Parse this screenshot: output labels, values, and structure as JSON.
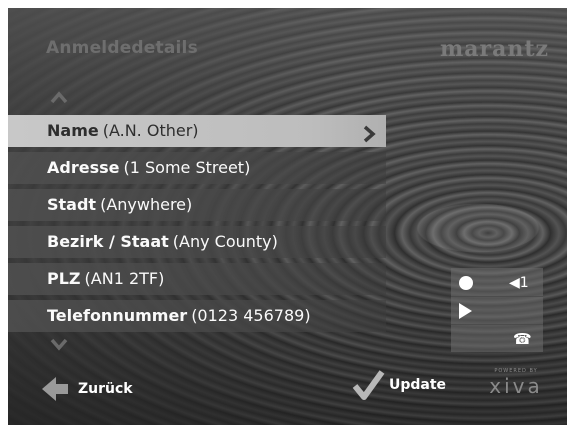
{
  "header": {
    "title": "Anmeldedetails",
    "logo": "marantz"
  },
  "menu": {
    "items": [
      {
        "label": "Name",
        "value": "(A.N. Other)",
        "selected": true
      },
      {
        "label": "Adresse",
        "value": "(1 Some Street)"
      },
      {
        "label": "Stadt",
        "value": "(Anywhere)"
      },
      {
        "label": "Bezirk / Staat",
        "value": "(Any County)"
      },
      {
        "label": "PLZ",
        "value": "(AN1 2TF)"
      },
      {
        "label": "Telefonnummer",
        "value": "(0123 456789)"
      }
    ]
  },
  "status_panel": {
    "row1_right": "◀1",
    "row3_right": "☎"
  },
  "footer": {
    "back_label": "Zurück",
    "update_label": "Update",
    "powered_small": "POWERED BY",
    "powered_brand": "xiva"
  },
  "icons": [
    "chevron-up-icon",
    "chevron-down-icon",
    "chevron-right-icon",
    "record-icon",
    "volume-icon",
    "play-icon",
    "phone-icon",
    "back-arrow-icon",
    "checkmark-icon"
  ],
  "colors": {
    "selected_bg": "#c8c8c8",
    "text": "#fafafa",
    "dim_text": "#6e6e6e"
  }
}
